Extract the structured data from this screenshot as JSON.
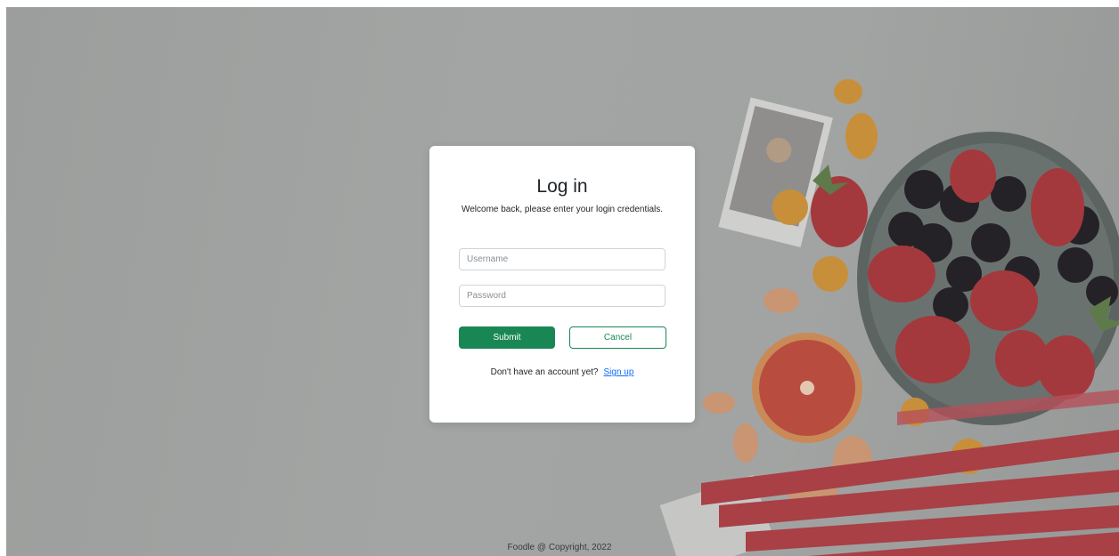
{
  "login": {
    "title": "Log in",
    "subtitle": "Welcome back, please enter your login credentials.",
    "username_placeholder": "Username",
    "password_placeholder": "Password",
    "submit_label": "Submit",
    "cancel_label": "Cancel",
    "signup_prompt": "Don't have an account yet?",
    "signup_link": "Sign up"
  },
  "footer": {
    "text": "Foodle @ Copyright, 2022"
  },
  "colors": {
    "primary": "#198754",
    "link": "#0d6efd",
    "backdrop": "#a2a4a3"
  }
}
